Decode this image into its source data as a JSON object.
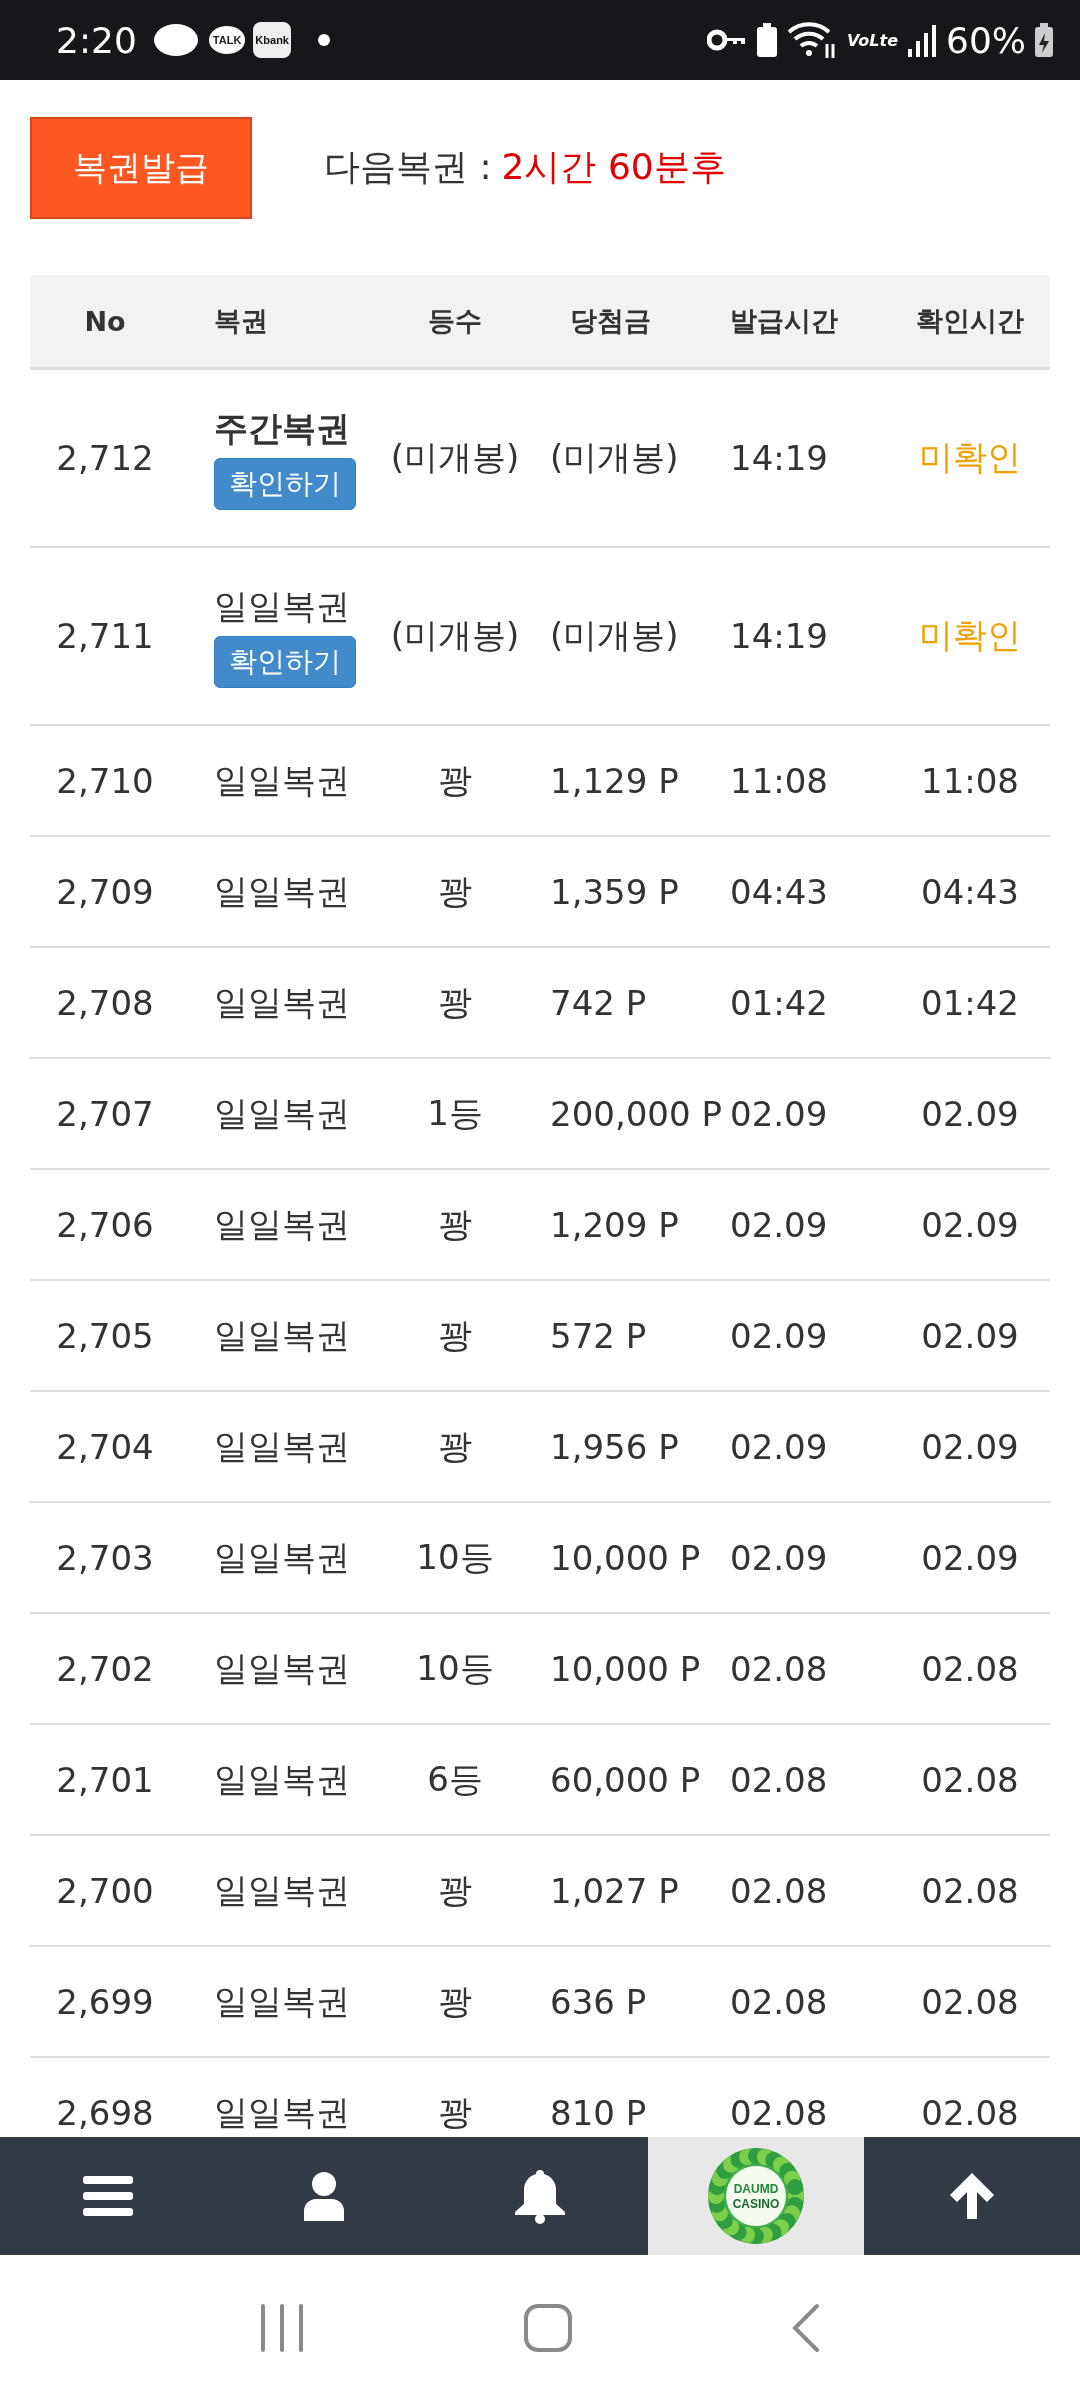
{
  "status_bar": {
    "time": "2:20",
    "app_icons": [
      "TALK",
      "Kbank"
    ],
    "network": "VoLte",
    "battery": "60%"
  },
  "header": {
    "issue_button": "복권발급",
    "next_label": "다음복권 :",
    "next_value": "2시간 60분후"
  },
  "table": {
    "columns": [
      "No",
      "복권",
      "등수",
      "당첨금",
      "발급시간",
      "확인시간"
    ],
    "rows": [
      {
        "no": "2,712",
        "lottery": "주간복권",
        "kind": "weekly",
        "button": "확인하기",
        "rank": "(미개봉)",
        "prize": "(미개봉)",
        "issued": "14:19",
        "confirmed": "미확인",
        "checked": false
      },
      {
        "no": "2,711",
        "lottery": "일일복권",
        "kind": "daily",
        "button": "확인하기",
        "rank": "(미개봉)",
        "prize": "(미개봉)",
        "issued": "14:19",
        "confirmed": "미확인",
        "checked": false
      },
      {
        "no": "2,710",
        "lottery": "일일복권",
        "kind": "daily",
        "rank": "꽝",
        "prize": "1,129 P",
        "issued": "11:08",
        "confirmed": "11:08",
        "checked": true
      },
      {
        "no": "2,709",
        "lottery": "일일복권",
        "kind": "daily",
        "rank": "꽝",
        "prize": "1,359 P",
        "issued": "04:43",
        "confirmed": "04:43",
        "checked": true
      },
      {
        "no": "2,708",
        "lottery": "일일복권",
        "kind": "daily",
        "rank": "꽝",
        "prize": "742 P",
        "issued": "01:42",
        "confirmed": "01:42",
        "checked": true
      },
      {
        "no": "2,707",
        "lottery": "일일복권",
        "kind": "daily",
        "rank": "1등",
        "prize": "200,000 P",
        "issued": "02.09",
        "confirmed": "02.09",
        "checked": true
      },
      {
        "no": "2,706",
        "lottery": "일일복권",
        "kind": "daily",
        "rank": "꽝",
        "prize": "1,209 P",
        "issued": "02.09",
        "confirmed": "02.09",
        "checked": true
      },
      {
        "no": "2,705",
        "lottery": "일일복권",
        "kind": "daily",
        "rank": "꽝",
        "prize": "572 P",
        "issued": "02.09",
        "confirmed": "02.09",
        "checked": true
      },
      {
        "no": "2,704",
        "lottery": "일일복권",
        "kind": "daily",
        "rank": "꽝",
        "prize": "1,956 P",
        "issued": "02.09",
        "confirmed": "02.09",
        "checked": true
      },
      {
        "no": "2,703",
        "lottery": "일일복권",
        "kind": "daily",
        "rank": "10등",
        "prize": "10,000 P",
        "issued": "02.09",
        "confirmed": "02.09",
        "checked": true
      },
      {
        "no": "2,702",
        "lottery": "일일복권",
        "kind": "daily",
        "rank": "10등",
        "prize": "10,000 P",
        "issued": "02.08",
        "confirmed": "02.08",
        "checked": true
      },
      {
        "no": "2,701",
        "lottery": "일일복권",
        "kind": "daily",
        "rank": "6등",
        "prize": "60,000 P",
        "issued": "02.08",
        "confirmed": "02.08",
        "checked": true
      },
      {
        "no": "2,700",
        "lottery": "일일복권",
        "kind": "daily",
        "rank": "꽝",
        "prize": "1,027 P",
        "issued": "02.08",
        "confirmed": "02.08",
        "checked": true
      },
      {
        "no": "2,699",
        "lottery": "일일복권",
        "kind": "daily",
        "rank": "꽝",
        "prize": "636 P",
        "issued": "02.08",
        "confirmed": "02.08",
        "checked": true
      },
      {
        "no": "2,698",
        "lottery": "일일복권",
        "kind": "daily",
        "rank": "꽝",
        "prize": "810 P",
        "issued": "02.08",
        "confirmed": "02.08",
        "checked": true
      }
    ]
  },
  "bottom_nav": {
    "logo_lines": [
      "DAUMD",
      "CASINO"
    ]
  }
}
